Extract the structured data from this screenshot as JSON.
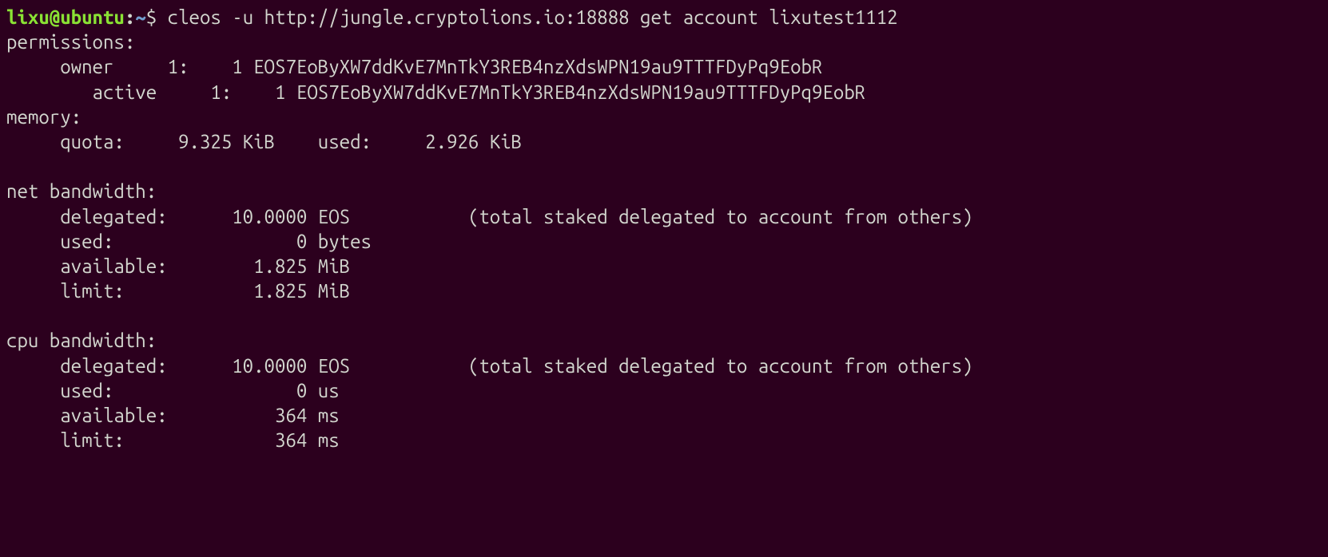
{
  "prompt": {
    "user": "lixu",
    "at": "@",
    "host": "ubuntu",
    "colon": ":",
    "path": "~",
    "dollar": "$ ",
    "command": "cleos -u http://jungle.cryptolions.io:18888 get account lixutest1112"
  },
  "output": {
    "permissions_header": "permissions: ",
    "owner_line": "     owner     1:    1 EOS7EoByXW7ddKvE7MnTkY3REB4nzXdsWPN19au9TTTFDyPq9EobR",
    "active_line": "        active     1:    1 EOS7EoByXW7ddKvE7MnTkY3REB4nzXdsWPN19au9TTTFDyPq9EobR",
    "memory_header": "memory: ",
    "memory_line": "     quota:     9.325 KiB    used:     2.926 KiB  ",
    "blank": "",
    "net_header": "net bandwidth: ",
    "net_delegated": "     delegated:      10.0000 EOS           (total staked delegated to account from others)",
    "net_used": "     used:                 0 bytes",
    "net_available": "     available:        1.825 MiB  ",
    "net_limit": "     limit:            1.825 MiB  ",
    "cpu_header": "cpu bandwidth:",
    "cpu_delegated": "     delegated:      10.0000 EOS           (total staked delegated to account from others)",
    "cpu_used": "     used:                 0 us   ",
    "cpu_available": "     available:          364 ms   ",
    "cpu_limit": "     limit:              364 ms   "
  }
}
